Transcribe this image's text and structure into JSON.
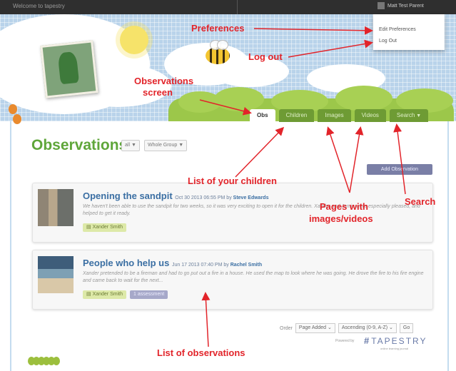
{
  "topbar": {
    "welcome": "Welcome to tapestry"
  },
  "user_menu": {
    "user_name": "Matt Test Parent",
    "items": [
      "Edit Preferences",
      "Log Out"
    ]
  },
  "nav": {
    "tabs": [
      "Obs",
      "Children",
      "Images",
      "Videos",
      "Search"
    ],
    "active": "Obs"
  },
  "page": {
    "title": "Observations",
    "filters": [
      "all",
      "Whole Group"
    ],
    "add_button": "Add Observation"
  },
  "observations": [
    {
      "title": "Opening the sandpit",
      "date": "Oct 30 2013 06:55 PM",
      "by_label": "by",
      "author": "Steve Edwards",
      "text": "We haven't been able to use the sandpit for two weeks, so it was very exciting to open it for the children. Xander and Jamie were especially pleased, and helped to get it ready.",
      "tags": [
        "Xander Smith"
      ]
    },
    {
      "title": "People who help us",
      "date": "Jun 17 2013 07:40 PM",
      "by_label": "by",
      "author": "Rachel Smith",
      "text": "Xander pretended to be a fireman and had to go put out a fire in a house. He used the map to look where he was going. He drove the fire to his fire engine and came back to wait for the next...",
      "tags": [
        "Xander Smith",
        "1 assessment"
      ]
    }
  ],
  "ordering": {
    "label": "Order",
    "sort_by": "Page Added",
    "direction": "Ascending (0-9, A-Z)",
    "go": "Go"
  },
  "footer": {
    "powered_by": "Powered by",
    "brand": "TAPESTRY",
    "tagline": "online learning journal"
  },
  "annotations": {
    "preferences": "Preferences",
    "log_out": "Log out",
    "observations_screen_1": "Observations",
    "observations_screen_2": "screen",
    "children": "List of your children",
    "pages_1": "Pages with",
    "pages_2": "images/videos",
    "search": "Search",
    "list_obs": "List of observations"
  },
  "colors": {
    "annotation": "#e2242a",
    "title_green": "#5fa63a",
    "link_blue": "#3b6fa3",
    "nav_green": "#6e9b34"
  },
  "icons": {
    "butterfly": "butterfly-icon",
    "bee": "bee-icon",
    "caterpillar": "caterpillar-icon",
    "tapestry": "tapestry-logo-icon"
  }
}
